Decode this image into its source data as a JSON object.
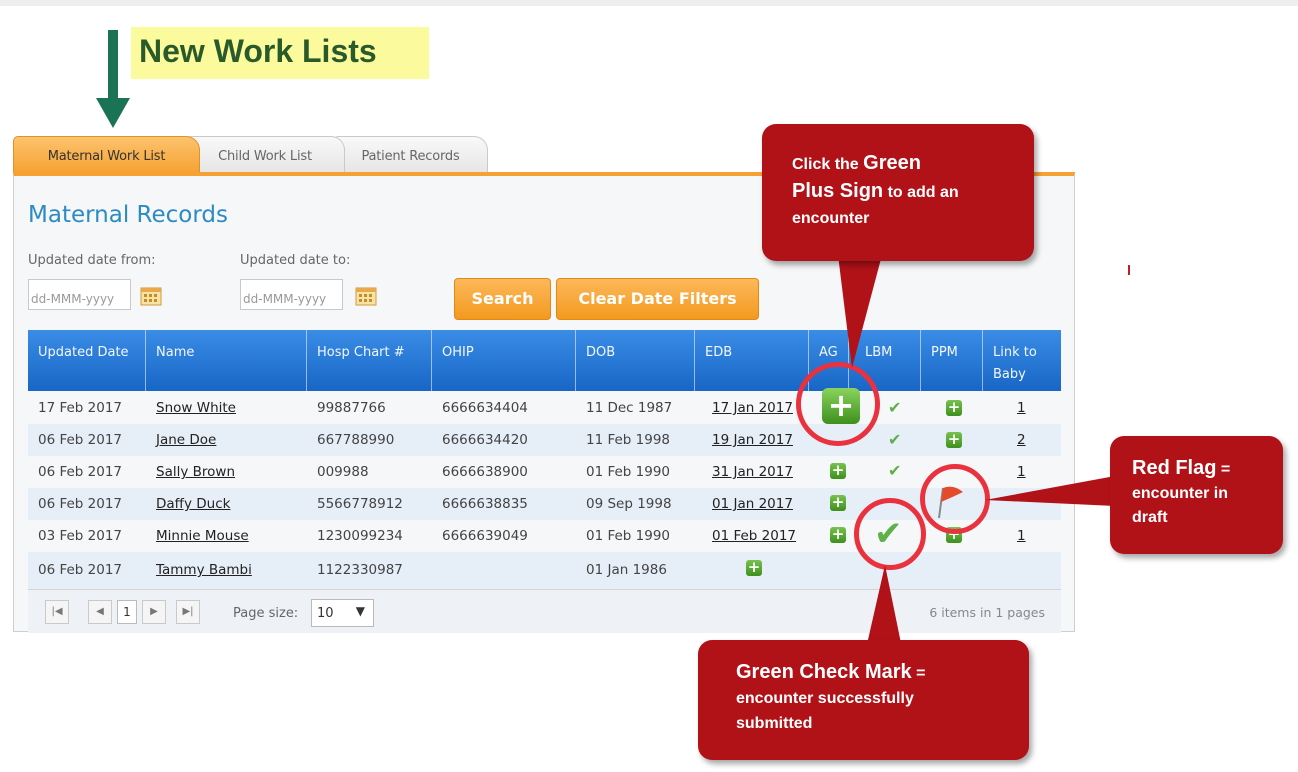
{
  "heading": {
    "text": "New Work Lists"
  },
  "tabs": [
    {
      "label": "Maternal Work List",
      "active": true
    },
    {
      "label": "Child Work List",
      "active": false
    },
    {
      "label": "Patient Records",
      "active": false
    }
  ],
  "panel": {
    "title": "Maternal Records"
  },
  "filters": {
    "from_label": "Updated date from:",
    "to_label": "Updated date to:",
    "from_placeholder": "dd-MMM-yyyy",
    "to_placeholder": "dd-MMM-yyyy",
    "search_label": "Search",
    "clear_label": "Clear Date Filters"
  },
  "grid": {
    "headers": [
      "Updated Date",
      "Name",
      "Hosp Chart #",
      "OHIP",
      "DOB",
      "EDB",
      "AG",
      "LBM",
      "PPM",
      "Link to Baby"
    ],
    "rows": [
      {
        "updated": "17 Feb 2017",
        "name": "Snow White",
        "chart": "99887766",
        "ohip": "6666634404",
        "dob": "11 Dec 1987",
        "edb": "17 Jan 2017",
        "link": "1"
      },
      {
        "updated": "06 Feb 2017",
        "name": "Jane Doe",
        "chart": "667788990",
        "ohip": "6666634420",
        "dob": "11 Feb 1998",
        "edb": "19 Jan 2017",
        "link": "2"
      },
      {
        "updated": "06 Feb 2017",
        "name": "Sally Brown",
        "chart": "009988",
        "ohip": "6666638900",
        "dob": "01 Feb 1990",
        "edb": "31 Jan 2017",
        "link": "1"
      },
      {
        "updated": "06 Feb 2017",
        "name": "Daffy Duck",
        "chart": "5566778912",
        "ohip": "6666638835",
        "dob": "09 Sep 1998",
        "edb": "01 Jan 2017",
        "link": ""
      },
      {
        "updated": "03 Feb 2017",
        "name": "Minnie Mouse",
        "chart": "1230099234",
        "ohip": "6666639049",
        "dob": "01 Feb 1990",
        "edb": "01 Feb 2017",
        "link": "1"
      },
      {
        "updated": "06 Feb 2017",
        "name": "Tammy Bambi",
        "chart": "1122330987",
        "ohip": "",
        "dob": "01 Jan 1986",
        "edb": "",
        "link": ""
      }
    ]
  },
  "pager": {
    "current_page": "1",
    "page_size_label": "Page size:",
    "page_size": "10",
    "info": "6 items in 1 pages"
  },
  "callouts": {
    "plus": {
      "line1a": "Click the ",
      "line1b": "Green",
      "line2a": "Plus Sign",
      "line2b": " to add an",
      "line3": "encounter"
    },
    "flag": {
      "line1a": "Red Flag",
      "line1b": " =",
      "line2": "encounter in",
      "line3": "draft"
    },
    "check": {
      "line1a": "Green Check Mark",
      "line1b": " =",
      "line2": "encounter successfully",
      "line3": "submitted"
    }
  },
  "colors": {
    "tab_active": "#f7a233",
    "header_blue": "#1866c6",
    "title_blue": "#2d8ac2",
    "callout_red": "#b11218",
    "circle_red": "#e9323e",
    "plus_green": "#3f8f1e",
    "check_green": "#5fb04a"
  }
}
